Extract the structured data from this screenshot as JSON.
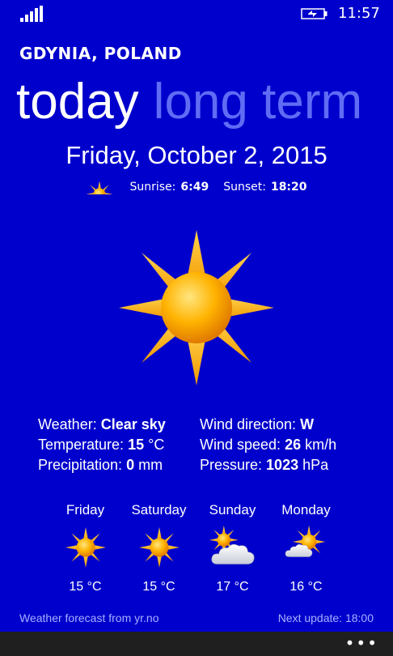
{
  "status": {
    "time": "11:57",
    "signal_icon": "signal-strength-icon",
    "battery_icon": "battery-charging-icon"
  },
  "location": "GDYNIA, POLAND",
  "pivot": {
    "active": "today",
    "inactive": "long term"
  },
  "date": "Friday, October 2, 2015",
  "sun": {
    "sunrise_label": "Sunrise:",
    "sunrise": "6:49",
    "sunset_label": "Sunset:",
    "sunset": "18:20"
  },
  "current": {
    "weather_label": "Weather:",
    "weather": "Clear sky",
    "temperature_label": "Temperature:",
    "temperature": "15",
    "temperature_unit": "°C",
    "precipitation_label": "Precipitation:",
    "precipitation": "0",
    "precipitation_unit": "mm",
    "wind_direction_label": "Wind direction:",
    "wind_direction": "W",
    "wind_speed_label": "Wind speed:",
    "wind_speed": "26",
    "wind_speed_unit": "km/h",
    "pressure_label": "Pressure:",
    "pressure": "1023",
    "pressure_unit": "hPa"
  },
  "forecast": [
    {
      "day": "Friday",
      "temp": "15 °C",
      "icon": "sun-icon"
    },
    {
      "day": "Saturday",
      "temp": "15 °C",
      "icon": "sun-icon"
    },
    {
      "day": "Sunday",
      "temp": "17 °C",
      "icon": "sun-cloud-icon"
    },
    {
      "day": "Monday",
      "temp": "16 °C",
      "icon": "sun-cloud-icon"
    }
  ],
  "footer": {
    "source": "Weather forecast from yr.no",
    "next_update": "Next update: 18:00"
  },
  "appbar": {
    "more": "•••"
  },
  "colors": {
    "background": "#0000cc",
    "pivot_inactive": "#5f6cf4",
    "sun": "#ffb300"
  }
}
